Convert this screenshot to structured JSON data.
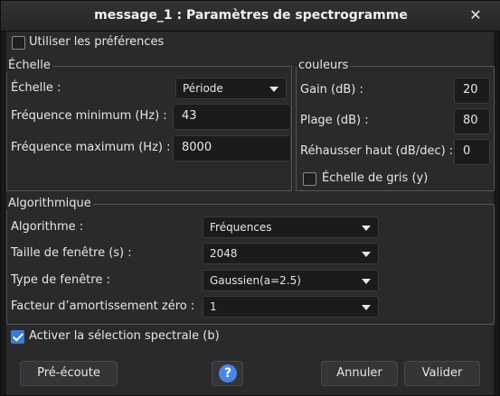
{
  "window": {
    "title": "message_1 : Paramètres de spectrogramme",
    "close_glyph": "✕"
  },
  "use_prefs": {
    "label": "Utiliser les préférences",
    "checked": false
  },
  "scale": {
    "group_title": "Échelle",
    "scale_label": "Échelle :",
    "scale_value": "Période",
    "min_freq_label": "Fréquence minimum (Hz) :",
    "min_freq_value": "43",
    "max_freq_label": "Fréquence maximum (Hz) :",
    "max_freq_value": "8000"
  },
  "colors": {
    "group_title": "couleurs",
    "gain_label": "Gain (dB) :",
    "gain_value": "20",
    "range_label": "Plage (dB) :",
    "range_value": "80",
    "boost_label": "Réhausser haut (dB/dec) :",
    "boost_value": "0",
    "grayscale_label": "Échelle de gris (y)",
    "grayscale_checked": false
  },
  "algorithm": {
    "group_title": "Algorithmique",
    "algo_label": "Algorithme :",
    "algo_value": "Fréquences",
    "window_size_label": "Taille de fenêtre (s) :",
    "window_size_value": "2048",
    "window_type_label": "Type de fenêtre :",
    "window_type_value": "Gaussien(a=2.5)",
    "zero_padding_label": "Facteur d’amortissement zéro :",
    "zero_padding_value": "1"
  },
  "spectral_selection": {
    "label": "Activer la sélection spectrale (b)",
    "checked": true
  },
  "buttons": {
    "preview": "Pré-écoute",
    "help": "?",
    "cancel": "Annuler",
    "ok": "Valider"
  },
  "colors_theme": {
    "accent": "#3c7ad6",
    "help_icon": "#4a86e8",
    "background": "#2a2a2c"
  }
}
